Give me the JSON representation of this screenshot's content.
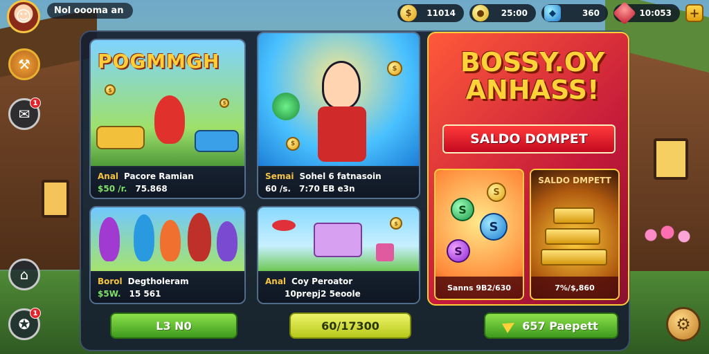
{
  "player": {
    "name": "Nol oooma an"
  },
  "currencies": [
    {
      "icon": "gold-chest-icon",
      "value": "11014"
    },
    {
      "icon": "coin-icon",
      "value": "25:00"
    },
    {
      "icon": "gem-icon",
      "value": "360"
    },
    {
      "icon": "ruby-icon",
      "value": "10:053"
    }
  ],
  "side_buttons": {
    "chat_badge": "1",
    "rewards_badge": "1"
  },
  "cards": [
    {
      "banner": "POGMMGH",
      "title_tag": "Anal",
      "title": "Pacore Ramian",
      "sub_tag": "$50 /r.",
      "sub": "75.868"
    },
    {
      "title_tag": "Semai",
      "title": "Sohel 6 fatnasoin",
      "sub_tag": "60 /s.",
      "sub": "7:70 EB e3n"
    },
    {
      "title_tag": "Borol",
      "title": "Degtholeram",
      "sub_tag": "$5W.",
      "sub": "15 561"
    },
    {
      "title_tag": "Anal",
      "title": "Coy Peroator",
      "sub": "10prepj2 5eoole"
    }
  ],
  "promo": {
    "title": "BOSSY.OY ANHASS!",
    "ribbon": "SALDO DOMPET",
    "left_caption": "Sanns 9B2/630",
    "right_label": "SALDO DMPETT",
    "right_caption": "7%/$,860"
  },
  "buttons": {
    "left": "L3 N0",
    "middle": "60/17300",
    "right": "657 Paepett"
  },
  "colors": {
    "accent_gold": "#ffcf3a",
    "button_green": "#3e9a1e",
    "button_yellow": "#b8c81a",
    "promo_red": "#c51a3a"
  }
}
